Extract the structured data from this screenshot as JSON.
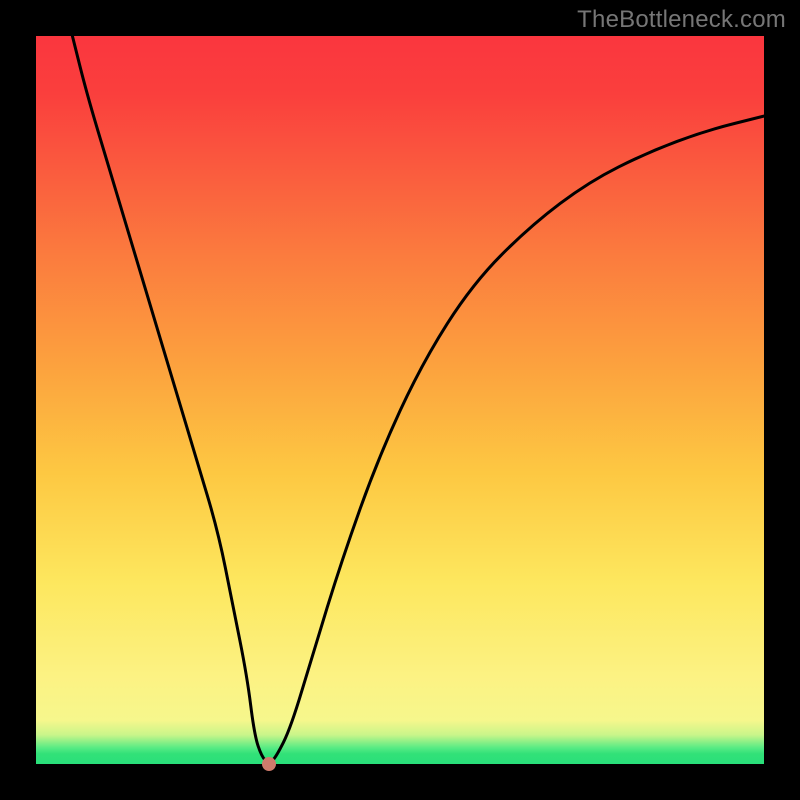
{
  "watermark": "TheBottleneck.com",
  "colors": {
    "frame": "#000000",
    "watermark": "#767676",
    "curve": "#000000",
    "dot": "#cf7b6c"
  },
  "chart_data": {
    "type": "line",
    "title": "",
    "xlabel": "",
    "ylabel": "",
    "xlim": [
      0,
      100
    ],
    "ylim": [
      0,
      100
    ],
    "grid": false,
    "legend": false,
    "series": [
      {
        "name": "bottleneck-curve",
        "x": [
          5,
          7,
          10,
          13,
          16,
          19,
          22,
          25,
          27,
          29,
          30,
          31,
          32,
          33,
          35,
          38,
          42,
          47,
          53,
          60,
          68,
          76,
          84,
          92,
          100
        ],
        "values": [
          100,
          92,
          82,
          72,
          62,
          52,
          42,
          32,
          22,
          12,
          4,
          1,
          0,
          1,
          5,
          15,
          28,
          42,
          55,
          66,
          74,
          80,
          84,
          87,
          89
        ]
      }
    ],
    "highlight": {
      "x": 32,
      "y": 0
    }
  }
}
